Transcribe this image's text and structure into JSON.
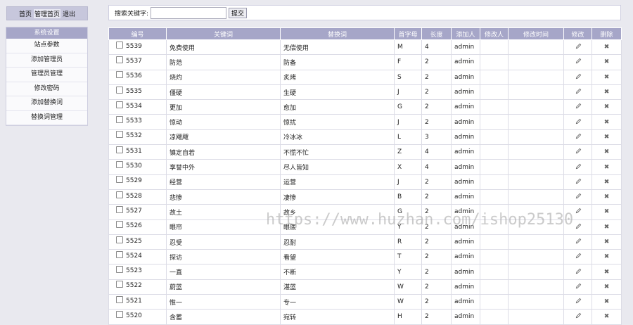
{
  "topnav": {
    "home": "首页",
    "admin_home": "管理首页",
    "logout": "退出"
  },
  "sidebar": {
    "title": "系统设置",
    "items": [
      {
        "label": "站点参数"
      },
      {
        "label": "添加管理员"
      },
      {
        "label": "管理员管理"
      },
      {
        "label": "修改密码"
      },
      {
        "label": "添加替换词"
      },
      {
        "label": "替换词管理"
      }
    ]
  },
  "search": {
    "label": "搜索关键字:",
    "value": "",
    "button": "提交"
  },
  "table": {
    "headers": [
      "编号",
      "关键词",
      "替换词",
      "首字母",
      "长度",
      "添加人",
      "修改人",
      "修改时间",
      "修改",
      "删除"
    ],
    "rows": [
      {
        "id": "5539",
        "kw": "免费使用",
        "rep": "无偿使用",
        "letter": "M",
        "len": "4",
        "adder": "admin",
        "editor": "",
        "time": ""
      },
      {
        "id": "5537",
        "kw": "防范",
        "rep": "防备",
        "letter": "F",
        "len": "2",
        "adder": "admin",
        "editor": "",
        "time": ""
      },
      {
        "id": "5536",
        "kw": "烧灼",
        "rep": "炙烤",
        "letter": "S",
        "len": "2",
        "adder": "admin",
        "editor": "",
        "time": ""
      },
      {
        "id": "5535",
        "kw": "僵硬",
        "rep": "生硬",
        "letter": "J",
        "len": "2",
        "adder": "admin",
        "editor": "",
        "time": ""
      },
      {
        "id": "5534",
        "kw": "更加",
        "rep": "愈加",
        "letter": "G",
        "len": "2",
        "adder": "admin",
        "editor": "",
        "time": ""
      },
      {
        "id": "5533",
        "kw": "惊动",
        "rep": "惊扰",
        "letter": "J",
        "len": "2",
        "adder": "admin",
        "editor": "",
        "time": ""
      },
      {
        "id": "5532",
        "kw": "凉飕飕",
        "rep": "冷冰冰",
        "letter": "L",
        "len": "3",
        "adder": "admin",
        "editor": "",
        "time": ""
      },
      {
        "id": "5531",
        "kw": "镇定自若",
        "rep": "不慌不忙",
        "letter": "Z",
        "len": "4",
        "adder": "admin",
        "editor": "",
        "time": ""
      },
      {
        "id": "5530",
        "kw": "享誉中外",
        "rep": "尽人皆知",
        "letter": "X",
        "len": "4",
        "adder": "admin",
        "editor": "",
        "time": ""
      },
      {
        "id": "5529",
        "kw": "经营",
        "rep": "运营",
        "letter": "J",
        "len": "2",
        "adder": "admin",
        "editor": "",
        "time": ""
      },
      {
        "id": "5528",
        "kw": "悲惨",
        "rep": "凄惨",
        "letter": "B",
        "len": "2",
        "adder": "admin",
        "editor": "",
        "time": ""
      },
      {
        "id": "5527",
        "kw": "故土",
        "rep": "故乡",
        "letter": "G",
        "len": "2",
        "adder": "admin",
        "editor": "",
        "time": ""
      },
      {
        "id": "5526",
        "kw": "眼帘",
        "rep": "眼底",
        "letter": "Y",
        "len": "2",
        "adder": "admin",
        "editor": "",
        "time": ""
      },
      {
        "id": "5525",
        "kw": "忍受",
        "rep": "忍耐",
        "letter": "R",
        "len": "2",
        "adder": "admin",
        "editor": "",
        "time": ""
      },
      {
        "id": "5524",
        "kw": "探访",
        "rep": "看望",
        "letter": "T",
        "len": "2",
        "adder": "admin",
        "editor": "",
        "time": ""
      },
      {
        "id": "5523",
        "kw": "一直",
        "rep": "不断",
        "letter": "Y",
        "len": "2",
        "adder": "admin",
        "editor": "",
        "time": ""
      },
      {
        "id": "5522",
        "kw": "蔚蓝",
        "rep": "湛蓝",
        "letter": "W",
        "len": "2",
        "adder": "admin",
        "editor": "",
        "time": ""
      },
      {
        "id": "5521",
        "kw": "惟一",
        "rep": "专一",
        "letter": "W",
        "len": "2",
        "adder": "admin",
        "editor": "",
        "time": ""
      },
      {
        "id": "5520",
        "kw": "含蓄",
        "rep": "宛转",
        "letter": "H",
        "len": "2",
        "adder": "admin",
        "editor": "",
        "time": ""
      }
    ]
  },
  "watermark": "https://www.huzhan.com/ishop25130",
  "colors": {
    "header_bg": "#a6a6c8",
    "page_bg": "#e9e9ef",
    "nav_bg": "#c7c7dc"
  }
}
